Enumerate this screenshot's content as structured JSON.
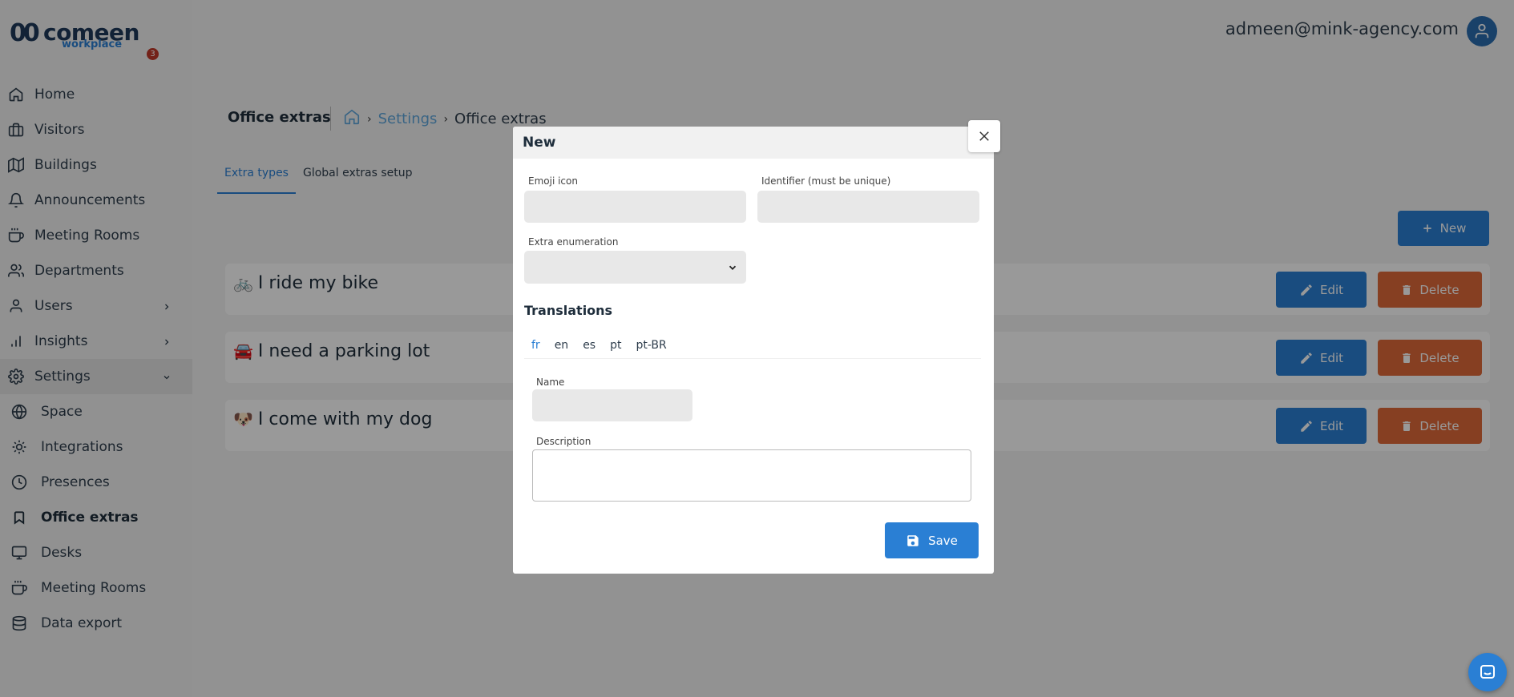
{
  "app": {
    "logo_mark": "00",
    "logo_name": "comeen",
    "logo_sub": "workplace",
    "notification_count": "3"
  },
  "sidebar": {
    "items": [
      {
        "label": "Home",
        "icon": "home-icon"
      },
      {
        "label": "Visitors",
        "icon": "briefcase-icon"
      },
      {
        "label": "Buildings",
        "icon": "map-icon"
      },
      {
        "label": "Announcements",
        "icon": "bell-icon"
      },
      {
        "label": "Meeting Rooms",
        "icon": "coffee-icon"
      },
      {
        "label": "Departments",
        "icon": "users-icon"
      },
      {
        "label": "Users",
        "icon": "user-icon"
      },
      {
        "label": "Insights",
        "icon": "bar-chart-icon"
      },
      {
        "label": "Settings",
        "icon": "gear-icon"
      }
    ],
    "settings_sub": [
      {
        "label": "Space",
        "icon": "globe-icon"
      },
      {
        "label": "Integrations",
        "icon": "cog-icon"
      },
      {
        "label": "Presences",
        "icon": "clock-icon"
      },
      {
        "label": "Office extras",
        "icon": "bookmark-icon"
      },
      {
        "label": "Desks",
        "icon": "monitor-icon"
      },
      {
        "label": "Meeting Rooms",
        "icon": "coffee-icon"
      },
      {
        "label": "Data export",
        "icon": "database-icon"
      }
    ]
  },
  "header": {
    "user_email": "admeen@mink-agency.com"
  },
  "page": {
    "title": "Office extras",
    "breadcrumb": [
      "Settings",
      "Office extras"
    ],
    "tabs": [
      "Extra types",
      "Global extras setup"
    ],
    "new_label": "New"
  },
  "extras": [
    {
      "emoji": "🚲",
      "label": "I ride my bike"
    },
    {
      "emoji": "🚘",
      "label": "I need a parking lot"
    },
    {
      "emoji": "🐶",
      "label": "I come with my dog"
    }
  ],
  "row_actions": {
    "edit_label": "Edit",
    "delete_label": "Delete"
  },
  "modal": {
    "title": "New",
    "fields": {
      "emoji_label": "Emoji icon",
      "emoji_value": "",
      "identifier_label": "Identifier (must be unique)",
      "identifier_value": "",
      "enumeration_label": "Extra enumeration",
      "enumeration_value": ""
    },
    "translations_title": "Translations",
    "languages": [
      "fr",
      "en",
      "es",
      "pt",
      "pt-BR"
    ],
    "active_language": "fr",
    "name_label": "Name",
    "name_value": "",
    "description_label": "Description",
    "description_value": "",
    "save_label": "Save"
  },
  "colors": {
    "primary": "#2a7fd4",
    "danger": "#e06a3a",
    "overlay": "rgba(0,0,0,0.4)"
  }
}
